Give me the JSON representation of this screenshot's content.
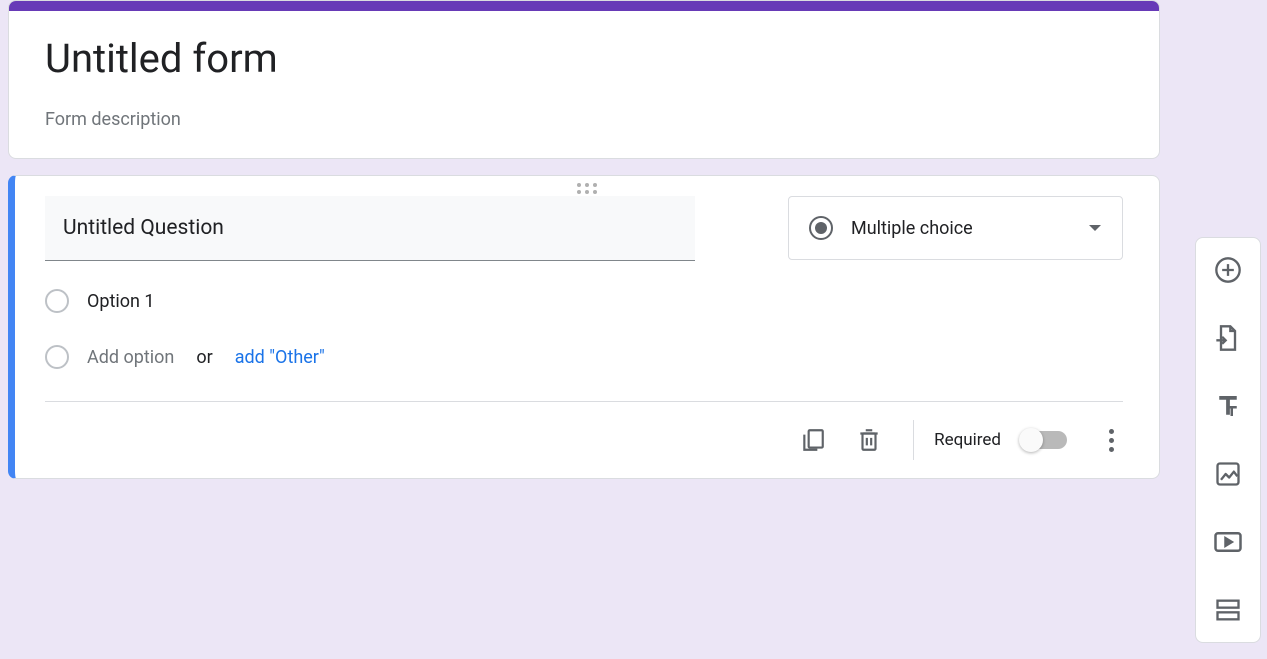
{
  "form": {
    "title": "Untitled form",
    "description_placeholder": "Form description"
  },
  "question": {
    "title": "Untitled Question",
    "type_label": "Multiple choice",
    "options": [
      {
        "label": "Option 1"
      }
    ],
    "add_option_text": "Add option",
    "or_text": "or",
    "add_other_text": "add \"Other\""
  },
  "footer": {
    "required_label": "Required"
  },
  "toolbar": {
    "items": [
      "add-question",
      "import-questions",
      "add-title",
      "add-image",
      "add-video",
      "add-section"
    ]
  }
}
